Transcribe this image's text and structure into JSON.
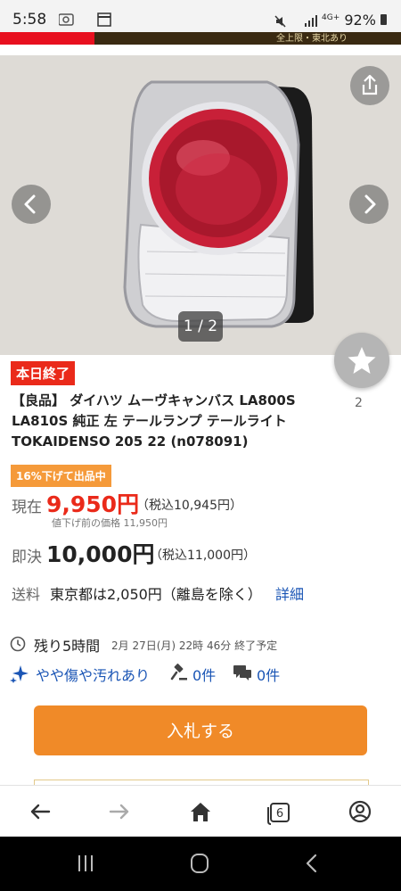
{
  "status_bar": {
    "time": "5:58",
    "battery": "92%",
    "network": "4G+"
  },
  "banner": {
    "text": "全上限・東北あり"
  },
  "gallery": {
    "counter": "1 / 2",
    "prev_glyph": "‹",
    "next_glyph": "›"
  },
  "favorite": {
    "count": "2"
  },
  "listing": {
    "end_badge": "本日終了",
    "title": "【良品】 ダイハツ ムーヴキャンバス LA800S LA810S 純正 左 テールランプ テールライト TOKAIDENSO 205 22 (n078091)",
    "discount_badge": "16%下げて出品中",
    "current_label": "現在",
    "current_price": "9,950円",
    "current_tax": "（税込10,945円）",
    "previous_price": "値下げ前の価格 11,950円",
    "bin_label": "即決",
    "bin_price": "10,000円",
    "bin_tax": "（税込11,000円）",
    "shipping_label": "送料",
    "shipping_text": "東京都は2,050円（離島を除く）",
    "shipping_detail": "詳細",
    "remaining": "残り5時間",
    "end_time": "2月 27日(月) 22時 46分 終了予定",
    "condition": "やや傷や汚れあり",
    "bids": "0件",
    "questions": "0件",
    "bid_button": "入札する"
  },
  "browser": {
    "tab_count": "6"
  },
  "colors": {
    "accent": "#f08a28",
    "price_red": "#ea2a1a",
    "link": "#1a55b5"
  }
}
